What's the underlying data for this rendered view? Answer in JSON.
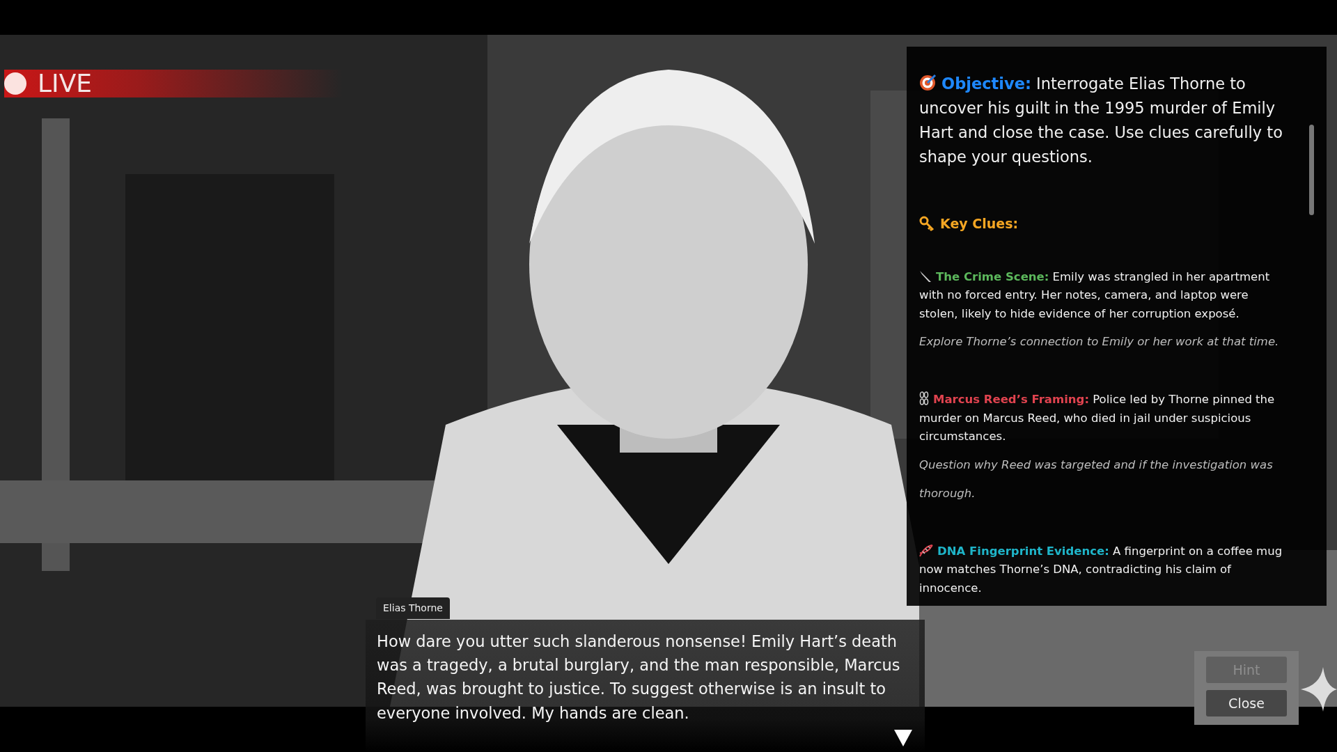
{
  "live": {
    "label": "LIVE"
  },
  "objective": {
    "label": "Objective:",
    "text": "Interrogate Elias Thorne to uncover his guilt in the 1995 murder of Emily Hart and close the case. Use clues carefully to shape your questions."
  },
  "clues_heading": "Key Clues:",
  "clues": [
    {
      "kind": "knife",
      "title": "The Crime Scene:",
      "color": "#5cb85c",
      "text": "Emily was strangled in her apartment with no forced entry. Her notes, camera, and laptop were stolen, likely to hide evidence of her corruption exposé.",
      "hint": "Explore Thorne’s connection to Emily or her work at that time."
    },
    {
      "kind": "chains",
      "title": "Marcus Reed’s Framing:",
      "color": "#e0434f",
      "text": "Police led by Thorne pinned the murder on Marcus Reed, who died in jail under suspicious circumstances.",
      "hint": "Question why Reed was targeted and if the investigation was thorough."
    },
    {
      "kind": "dna",
      "title": "DNA Fingerprint Evidence:",
      "color": "#1fb5c9",
      "text": "A fingerprint on a coffee mug now matches Thorne’s DNA, contradicting his claim of innocence."
    }
  ],
  "dialogue": {
    "speaker": "Elias Thorne",
    "text": "How dare you utter such slanderous nonsense! Emily Hart’s death was a tragedy, a brutal burglary, and the man responsible, Marcus Reed, was brought to justice. To suggest otherwise is an insult to everyone involved. My hands are clean."
  },
  "buttons": [
    {
      "label": "Hint",
      "disabled": true
    },
    {
      "label": "Close",
      "disabled": false
    }
  ]
}
